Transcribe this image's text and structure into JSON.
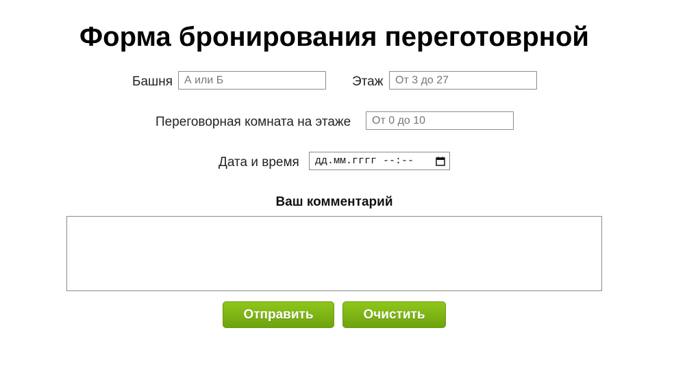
{
  "page": {
    "title": "Форма бронирования переготоврной"
  },
  "form": {
    "tower": {
      "label": "Башня",
      "placeholder": "А или Б",
      "value": ""
    },
    "floor": {
      "label": "Этаж",
      "placeholder": "От 3 до 27",
      "value": ""
    },
    "room": {
      "label": "Переговорная комната на этаже",
      "placeholder": "От 0 до 10",
      "value": ""
    },
    "datetime": {
      "label": "Дата и время",
      "display": "дд.мм.гггг --:--",
      "icon": "calendar-icon"
    },
    "comment": {
      "label": "Ваш комментарий",
      "value": ""
    },
    "buttons": {
      "submit": "Отправить",
      "clear": "Очистить"
    }
  },
  "colors": {
    "button_bg": "#7cb514",
    "button_text": "#ffffff",
    "input_border": "#8a8a8a"
  }
}
